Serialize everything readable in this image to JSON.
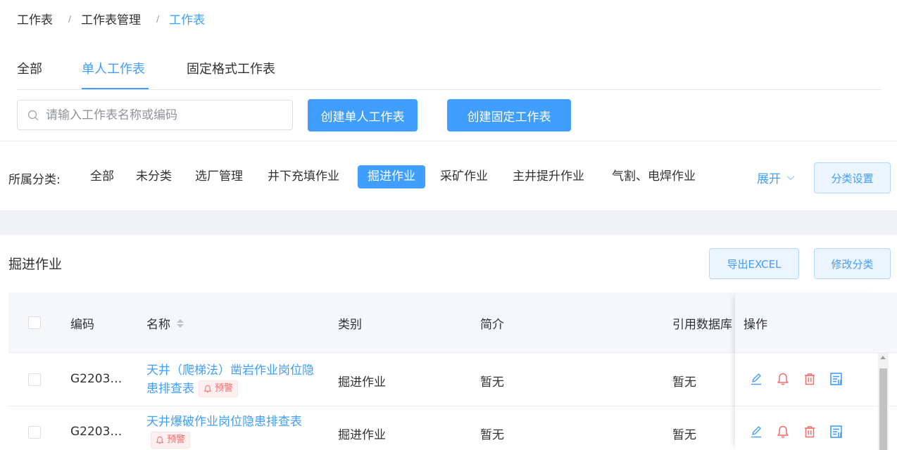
{
  "breadcrumb": {
    "items": [
      "工作表",
      "工作表管理",
      "工作表"
    ],
    "separator": "/"
  },
  "tabs": [
    "全部",
    "单人工作表",
    "固定格式工作表"
  ],
  "search": {
    "placeholder": "请输入工作表名称或编码",
    "value": ""
  },
  "actions": {
    "create_single": "创建单人工作表",
    "create_fixed": "创建固定工作表"
  },
  "filter": {
    "label": "所属分类:",
    "categories": [
      "全部",
      "未分类",
      "选厂管理",
      "井下充填作业",
      "掘进作业",
      "采矿作业",
      "主井提升作业",
      "气割、电焊作业"
    ],
    "active": "掘进作业",
    "expand": "展开",
    "settings": "分类设置"
  },
  "section": {
    "title": "掘进作业",
    "export": "导出EXCEL",
    "change_category": "修改分类"
  },
  "table": {
    "headers": {
      "code": "编码",
      "name": "名称",
      "category": "类别",
      "intro": "简介",
      "db": "引用数据库",
      "ops": "操作"
    },
    "rows": [
      {
        "code": "G2203…",
        "name": "天井（爬梯法）凿岩作业岗位隐患排查表",
        "badge": "预警",
        "category": "掘进作业",
        "intro": "暂无",
        "db": "暂无"
      },
      {
        "code": "G2203…",
        "name": "天井爆破作业岗位隐患排查表",
        "badge": "预警",
        "category": "掘进作业",
        "intro": "暂无",
        "db": "暂无"
      }
    ]
  },
  "colors": {
    "primary": "#409eff",
    "danger": "#f56c6c",
    "text": "#303133",
    "header_bg": "#f5f7fa"
  }
}
